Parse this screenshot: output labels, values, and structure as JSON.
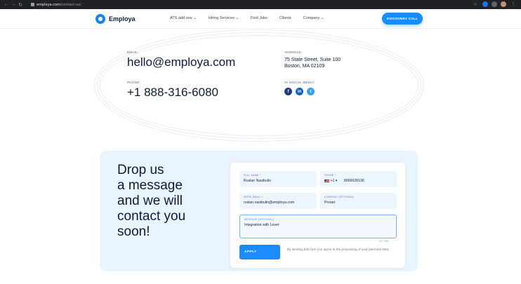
{
  "browser": {
    "url_domain": "employa.com",
    "url_path": "/contact-us/"
  },
  "header": {
    "logo_text": "Employa",
    "nav": [
      "ATS add-ons ⌄",
      "Hiring Services ⌄",
      "Find Jobs",
      "Clients",
      "Company ⌄"
    ],
    "cta_label": "DISCOVERY CALL"
  },
  "contact": {
    "email_label": "EMAIL:",
    "email": "hello@employa.com",
    "phone_label": "PHONE:",
    "phone": "+1 888-316-6080",
    "address_label": "ADDRESS:",
    "address_line1": "75 State Street, Suite 100",
    "address_line2": "Boston, MA 02109",
    "social_label": "IN SOCIAL MEDIA:",
    "socials": [
      {
        "icon": "facebook-icon",
        "glyph": "f",
        "color": "#1d3e7a"
      },
      {
        "icon": "linkedin-icon",
        "glyph": "in",
        "color": "#1062b8"
      },
      {
        "icon": "twitter-icon",
        "glyph": "t",
        "color": "#2ea3f2"
      }
    ]
  },
  "form": {
    "headline": [
      "Drop us",
      "a message",
      "and we will",
      "contact you",
      "soon!"
    ],
    "full_name_label": "FULL NAME *",
    "full_name_value": "Ruslan Nasibulin",
    "phone_label": "PHONE *",
    "phone_code": "+1 ▾",
    "phone_value": "8006628196",
    "work_email_label": "WORK EMAIL *",
    "work_email_value": "ruslan.nasibulin@employa.com",
    "company_label": "COMPANY (OPTIONAL)",
    "company_value": "Proset",
    "message_label": "MESSAGE (OPTIONAL)",
    "message_value": "Integration with Lever",
    "counter": "22 / 300",
    "apply_label": "APPLY",
    "consent_text": "By sending this form you agree to the processing of your personal data."
  },
  "colors": {
    "accent": "#1a8cff",
    "dark_text": "#0e1a3a",
    "form_bg": "#eaf4fe"
  }
}
